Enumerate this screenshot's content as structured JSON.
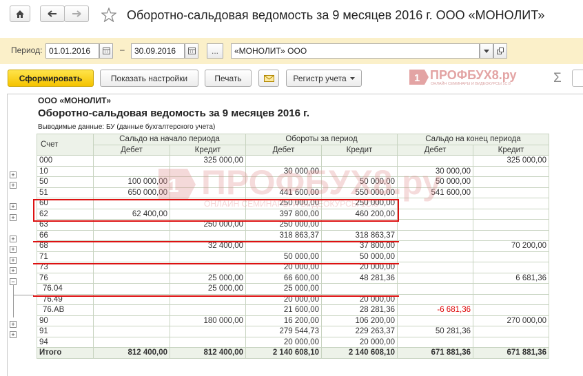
{
  "window": {
    "title": "Оборотно-сальдовая ведомость за 9 месяцев 2016 г. ООО «МОНОЛИТ»"
  },
  "filter": {
    "period_label": "Период:",
    "date_from": "01.01.2016",
    "dash": "–",
    "date_to": "30.09.2016",
    "dots": "...",
    "organization": "«МОНОЛИТ» ООО"
  },
  "toolbar": {
    "generate": "Сформировать",
    "show_settings": "Показать настройки",
    "print": "Печать",
    "register": "Регистр учета",
    "sigma": "Σ"
  },
  "brand": {
    "name": "ПРОФБУХ8.ру",
    "tagline": "ОНЛАЙН СЕМИНАРЫ И ВИДЕОКУРСЫ 1С:8"
  },
  "report": {
    "org": "ООО «МОНОЛИТ»",
    "title": "Оборотно-сальдовая ведомость за 9 месяцев 2016 г.",
    "data_output": "Выводимые данные:  БУ (данные бухгалтерского учета)",
    "headers": {
      "account": "Счет",
      "opening": "Сальдо на начало периода",
      "turnover": "Обороты за период",
      "closing": "Сальдо на конец периода",
      "debit": "Дебет",
      "credit": "Кредит"
    },
    "rows": [
      {
        "acc": "000",
        "v": [
          "",
          "325 000,00",
          "",
          "",
          "",
          "325 000,00"
        ]
      },
      {
        "acc": "10",
        "v": [
          "",
          "",
          "30 000,00",
          "",
          "30 000,00",
          ""
        ],
        "exp": "+"
      },
      {
        "acc": "50",
        "v": [
          "100 000,00",
          "",
          "",
          "50 000,00",
          "50 000,00",
          ""
        ],
        "exp": "+"
      },
      {
        "acc": "51",
        "v": [
          "650 000,00",
          "",
          "441 600,00",
          "550 000,00",
          "541 600,00",
          ""
        ]
      },
      {
        "acc": "60",
        "v": [
          "",
          "",
          "250 000,00",
          "250 000,00",
          "",
          ""
        ],
        "exp": "+"
      },
      {
        "acc": "62",
        "v": [
          "62 400,00",
          "",
          "397 800,00",
          "460 200,00",
          "",
          ""
        ],
        "exp": "+"
      },
      {
        "acc": "63",
        "v": [
          "",
          "250 000,00",
          "250 000,00",
          "",
          "",
          ""
        ]
      },
      {
        "acc": "66",
        "v": [
          "",
          "",
          "318 863,37",
          "318 863,37",
          "",
          ""
        ],
        "exp": "+"
      },
      {
        "acc": "68",
        "v": [
          "",
          "32 400,00",
          "",
          "37 800,00",
          "",
          "70 200,00"
        ],
        "exp": "+"
      },
      {
        "acc": "71",
        "v": [
          "",
          "",
          "50 000,00",
          "50 000,00",
          "",
          ""
        ],
        "exp": "+"
      },
      {
        "acc": "73",
        "v": [
          "",
          "",
          "20 000,00",
          "20 000,00",
          "",
          ""
        ],
        "exp": "+"
      },
      {
        "acc": "76",
        "v": [
          "",
          "25 000,00",
          "66 600,00",
          "48 281,36",
          "",
          "6 681,36"
        ],
        "exp": "−"
      },
      {
        "acc": "76.04",
        "v": [
          "",
          "25 000,00",
          "25 000,00",
          "",
          "",
          ""
        ],
        "sub": true
      },
      {
        "acc": "76.49",
        "v": [
          "",
          "",
          "20 000,00",
          "20 000,00",
          "",
          ""
        ],
        "sub": true
      },
      {
        "acc": "76.АВ",
        "v": [
          "",
          "",
          "21 600,00",
          "28 281,36",
          "-6 681,36",
          ""
        ],
        "sub": true
      },
      {
        "acc": "90",
        "v": [
          "",
          "180 000,00",
          "16 200,00",
          "106 200,00",
          "",
          "270 000,00"
        ],
        "exp": "+"
      },
      {
        "acc": "91",
        "v": [
          "",
          "",
          "279 544,73",
          "229 263,37",
          "50 281,36",
          ""
        ],
        "exp": "+"
      },
      {
        "acc": "94",
        "v": [
          "",
          "",
          "20 000,00",
          "20 000,00",
          "",
          ""
        ]
      }
    ],
    "total": {
      "acc": "Итого",
      "v": [
        "812 400,00",
        "812 400,00",
        "2 140 608,10",
        "2 140 608,10",
        "671 881,36",
        "671 881,36"
      ]
    }
  },
  "colors": {
    "accent_yellow": "#f5c300",
    "filter_bg": "#fbf0c9",
    "header_bg": "#edf2e9",
    "highlight_red": "#d11111",
    "negative_red": "#dd0000"
  }
}
